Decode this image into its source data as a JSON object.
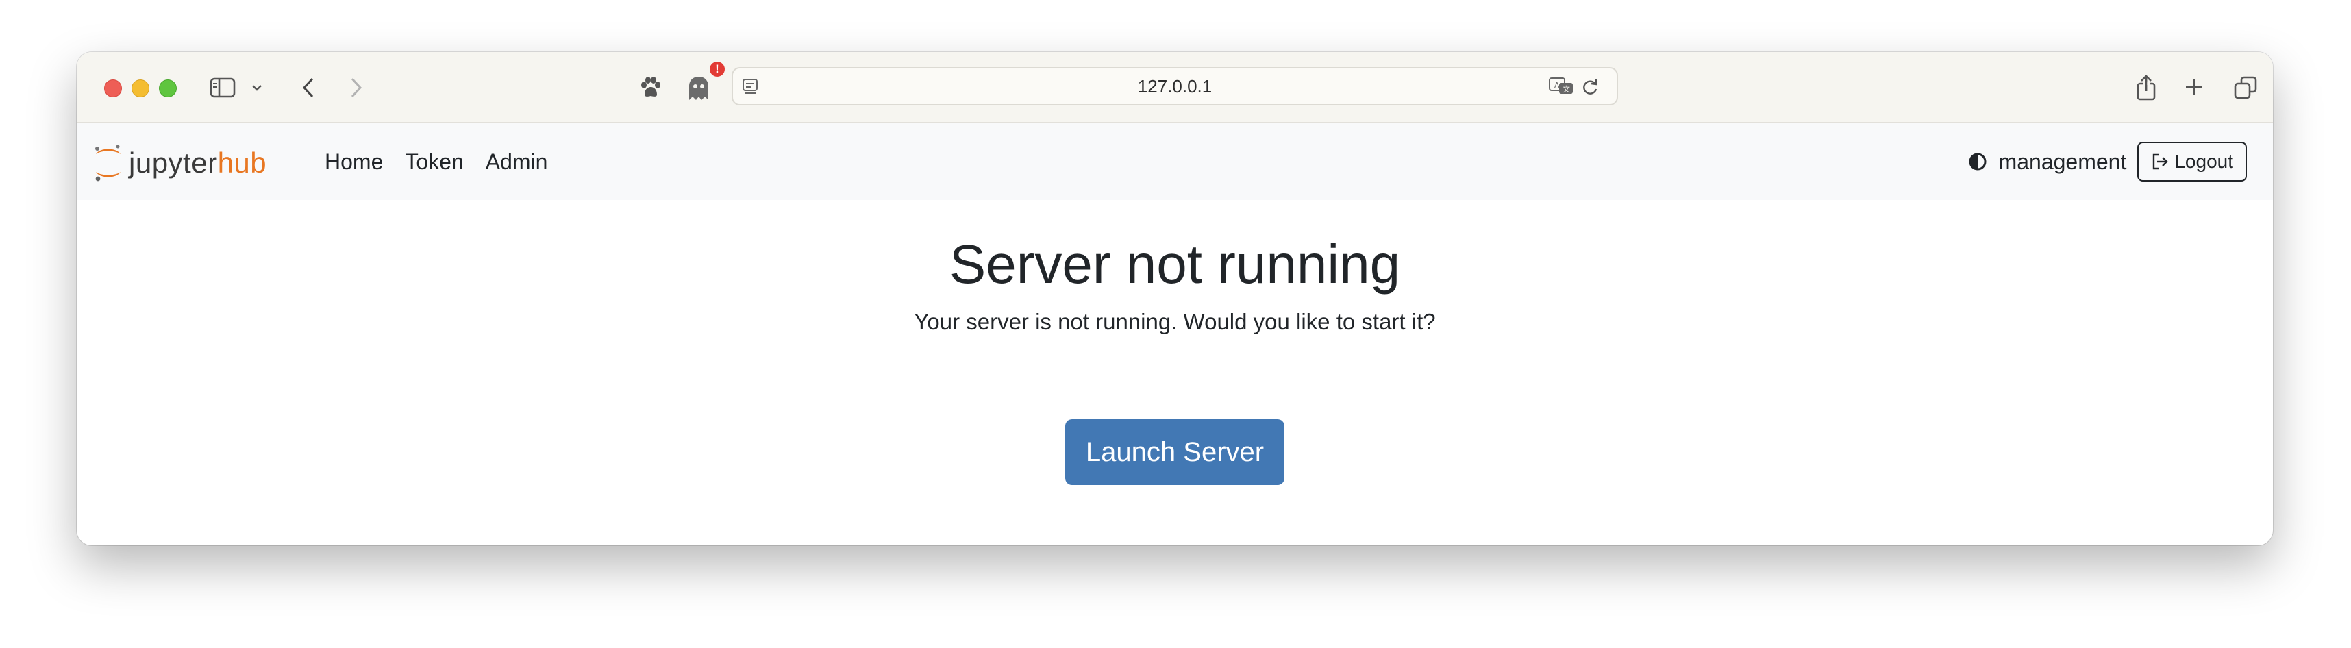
{
  "browser": {
    "url": "127.0.0.1",
    "extension_badge": "!",
    "icons": {
      "sidebar": "sidebar-icon",
      "chevron": "chevron-down-icon",
      "back": "back-arrow-icon",
      "forward": "forward-arrow-icon",
      "paw": "paw-icon",
      "ghost": "ghost-icon",
      "page": "page-icon",
      "translate": "translate-icon",
      "reload": "reload-icon",
      "share": "share-icon",
      "new_tab": "plus-icon",
      "tabs": "tabs-overview-icon"
    }
  },
  "navbar": {
    "logo_text_1": "jupyter",
    "logo_text_2": "hub",
    "links": [
      {
        "label": "Home"
      },
      {
        "label": "Token"
      },
      {
        "label": "Admin"
      }
    ],
    "username": "management",
    "logout_label": "Logout",
    "theme_icon": "contrast-icon"
  },
  "main": {
    "title": "Server not running",
    "subtitle": "Your server is not running. Would you like to start it?",
    "launch_label": "Launch Server"
  },
  "colors": {
    "accent": "#4278b4",
    "hub_orange": "#e87722",
    "navbar_bg": "#f8f9fa",
    "toolbar_bg": "#f6f5f0"
  }
}
